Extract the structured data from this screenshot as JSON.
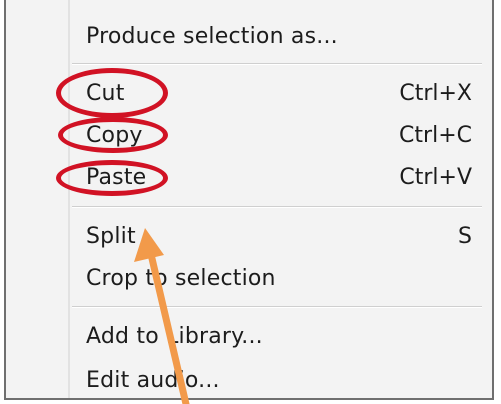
{
  "menu": {
    "items": [
      {
        "label": "Produce selection as...",
        "shortcut": ""
      },
      {
        "label": "Cut",
        "shortcut": "Ctrl+X"
      },
      {
        "label": "Copy",
        "shortcut": "Ctrl+C"
      },
      {
        "label": "Paste",
        "shortcut": "Ctrl+V"
      },
      {
        "label": "Split",
        "shortcut": "S"
      },
      {
        "label": "Crop to selection",
        "shortcut": ""
      },
      {
        "label": "Add to Library...",
        "shortcut": ""
      },
      {
        "label": "Edit audio...",
        "shortcut": ""
      }
    ]
  },
  "annotations": {
    "highlight_color": "#d11224",
    "arrow_color": "#f29a4a",
    "highlighted_items": [
      "Cut",
      "Copy",
      "Paste"
    ]
  }
}
